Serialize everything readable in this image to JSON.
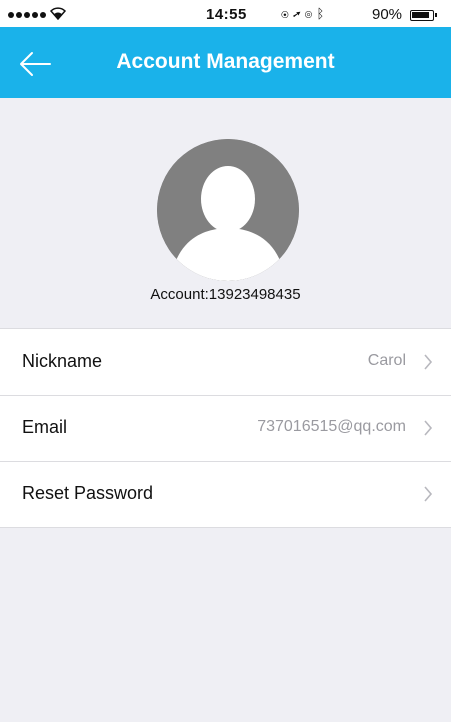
{
  "status_bar": {
    "time": "14:55",
    "battery_percent": "90%",
    "signal_dots": 5,
    "icons": [
      "wifi-icon",
      "lock-rotation-icon",
      "location-icon",
      "alarm-icon",
      "bluetooth-icon",
      "battery-icon"
    ]
  },
  "nav": {
    "title": "Account Management",
    "back_icon": "back-arrow-icon",
    "color": "#1ab2ea"
  },
  "profile": {
    "avatar_icon": "user-avatar-icon",
    "account_text": "Account:13923498435"
  },
  "settings": {
    "items": [
      {
        "label": "Nickname",
        "value": "Carol"
      },
      {
        "label": "Email",
        "value": "737016515@qq.com"
      },
      {
        "label": "Reset Password",
        "value": ""
      }
    ]
  },
  "colors": {
    "accent": "#1ab2ea",
    "background": "#efeff4",
    "secondary_text": "#9a9aa0"
  }
}
